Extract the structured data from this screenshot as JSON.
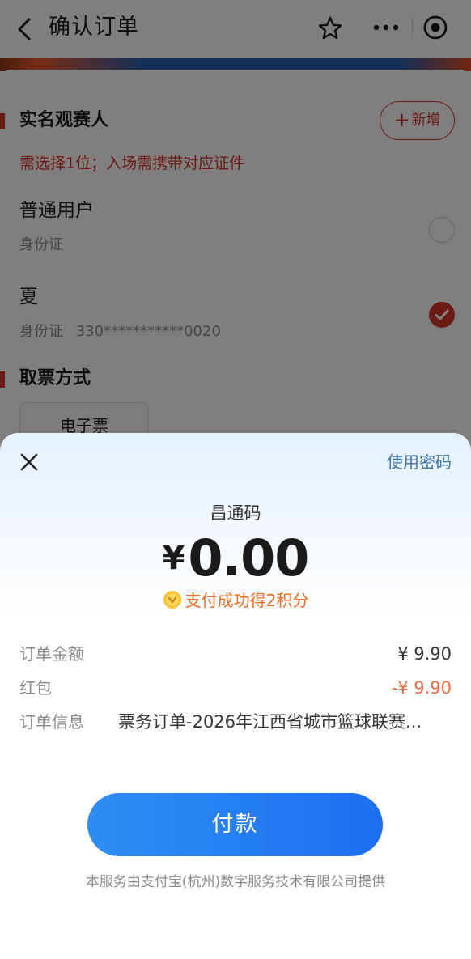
{
  "navbar": {
    "title": "确认订单",
    "back_icon": "chevron-left-icon",
    "favorite_icon": "star-icon",
    "more_icon": "more-dots-icon",
    "close_miniapp_icon": "target-icon"
  },
  "order_page": {
    "attendee_section_title": "实名观赛人",
    "add_button_label": "新增",
    "attendee_hint": "需选择1位；入场需携带对应证件",
    "attendees": [
      {
        "name": "普通用户",
        "id_type": "身份证",
        "id_number": "",
        "selected": false
      },
      {
        "name": "夏",
        "id_type": "身份证",
        "id_number": "330***********0020",
        "selected": true
      }
    ],
    "ticket_section_title": "取票方式",
    "ticket_option": "电子票"
  },
  "payment_sheet": {
    "use_password_label": "使用密码",
    "merchant": "昌通码",
    "currency_symbol": "¥",
    "amount": "0.00",
    "reward_text": "支付成功得2积分",
    "details": {
      "order_amount_label": "订单金额",
      "order_amount_value": "¥ 9.90",
      "red_packet_label": "红包",
      "red_packet_value": "-¥ 9.90",
      "order_info_label": "订单信息",
      "order_info_value": "票务订单-2026年江西省城市篮球联赛..."
    },
    "pay_button_label": "付款",
    "footer_note": "本服务由支付宝(杭州)数字服务技术有限公司提供"
  },
  "colors": {
    "accent_red": "#d7342a",
    "pay_blue": "#1c6fef",
    "reward_orange": "#f06a1f"
  }
}
